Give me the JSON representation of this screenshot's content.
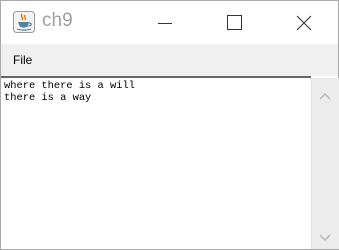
{
  "window": {
    "title": "ch9",
    "icon": "java-coffee-cup-icon",
    "controls": [
      "minimize-icon",
      "maximize-icon",
      "close-icon"
    ]
  },
  "menubar": {
    "items": [
      {
        "label": "File"
      }
    ]
  },
  "editor": {
    "lines": [
      "where there is a will",
      "there is a way"
    ]
  },
  "colors": {
    "title_text": "#a0a0a0",
    "menubar_bg": "#f0f0f0",
    "scrollbar_bg": "#ececec",
    "java_orange": "#e76f00",
    "java_blue": "#5382a1"
  }
}
